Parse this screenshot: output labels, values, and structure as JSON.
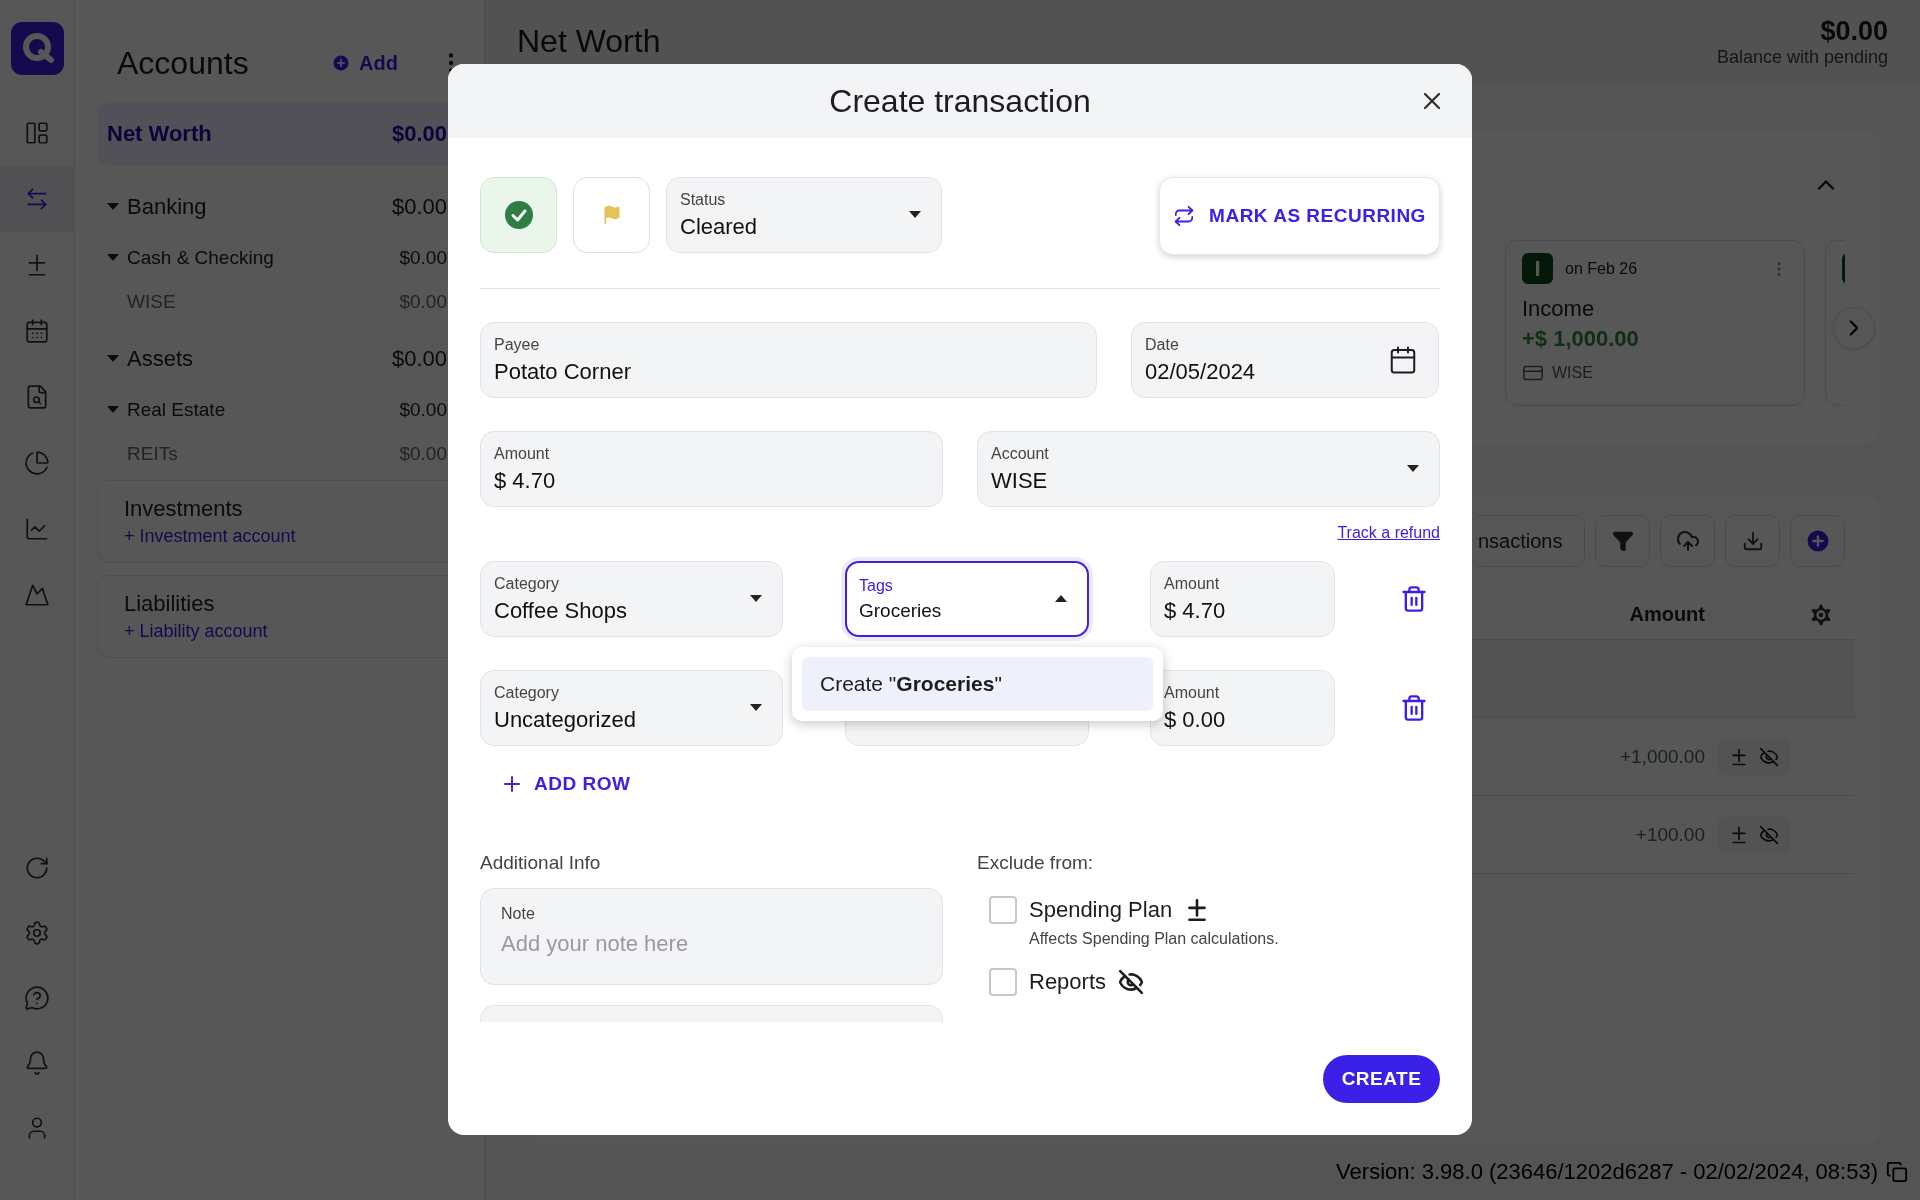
{
  "rail": {
    "items": [
      {
        "selected": false
      },
      {
        "selected": true
      },
      {
        "selected": false
      },
      {
        "selected": false
      },
      {
        "selected": false
      },
      {
        "selected": false
      },
      {
        "selected": false
      },
      {
        "selected": false
      }
    ]
  },
  "sidebar": {
    "title": "Accounts",
    "add_label": "Add",
    "net_worth": {
      "label": "Net Worth",
      "value": "$0.00",
      "selected": true
    },
    "tree": [
      {
        "label": "Banking",
        "value": "$0.00",
        "expanded": true,
        "children": [
          {
            "label": "Cash & Checking",
            "value": "$0.00",
            "expanded": true,
            "children": [
              {
                "label": "WISE",
                "value": "$0.00"
              }
            ]
          }
        ]
      },
      {
        "label": "Assets",
        "value": "$0.00",
        "expanded": true,
        "children": [
          {
            "label": "Real Estate",
            "value": "$0.00",
            "expanded": true,
            "children": [
              {
                "label": "REITs",
                "value": "$0.00"
              }
            ]
          }
        ]
      }
    ],
    "sections": [
      {
        "title": "Investments",
        "link": "+ Investment account"
      },
      {
        "title": "Liabilities",
        "link": "+ Liability account"
      }
    ]
  },
  "header": {
    "title": "Net Worth",
    "balance": "$0.00",
    "balance_label": "Balance with pending"
  },
  "recurring": {
    "expanded": true,
    "cards": [
      {
        "initial": "I",
        "date": "on Feb 26",
        "name": "Income",
        "amount": "+$ 1,000.00",
        "account": "WISE"
      }
    ]
  },
  "transactions": {
    "search": {
      "placeholder": "nsactions"
    },
    "columns": [
      "Amount"
    ],
    "rows": [
      {
        "amount": "+1,000.00"
      },
      {
        "amount": "+100.00"
      }
    ]
  },
  "modal": {
    "title": "Create transaction",
    "cleared": true,
    "status": {
      "label": "Status",
      "value": "Cleared"
    },
    "recurring_button": "MARK AS RECURRING",
    "payee": {
      "label": "Payee",
      "value": "Potato Corner"
    },
    "date": {
      "label": "Date",
      "value": "02/05/2024"
    },
    "amount": {
      "label": "Amount",
      "value": "$ 4.70"
    },
    "account": {
      "label": "Account",
      "value": "WISE"
    },
    "refund_link": "Track a refund",
    "splits": [
      {
        "category": {
          "label": "Category",
          "value": "Coffee Shops"
        },
        "tags": {
          "label": "Tags",
          "value": "Groceries",
          "focused": true
        },
        "amount": {
          "label": "Amount",
          "value": "$ 4.70"
        }
      },
      {
        "category": {
          "label": "Category",
          "value": "Uncategorized"
        },
        "tags": {
          "focused": false
        },
        "amount": {
          "label": "Amount",
          "value": "$ 0.00"
        }
      }
    ],
    "tag_menu": {
      "items": [
        {
          "label": "Create \"**Groceries**\"",
          "selected": true
        }
      ]
    },
    "add_row": "ADD ROW",
    "additional_info": {
      "title": "Additional Info",
      "note": {
        "label": "Note",
        "placeholder": "Add your note here"
      }
    },
    "exclude": {
      "title": "Exclude from:",
      "options": [
        {
          "label": "Spending Plan",
          "checked": false,
          "description": "Affects Spending Plan calculations."
        },
        {
          "label": "Reports",
          "checked": false
        }
      ]
    },
    "create_button": "CREATE"
  },
  "version": "Version: 3.98.0 (23646/1202d6287 - 02/02/2024, 08:53)"
}
